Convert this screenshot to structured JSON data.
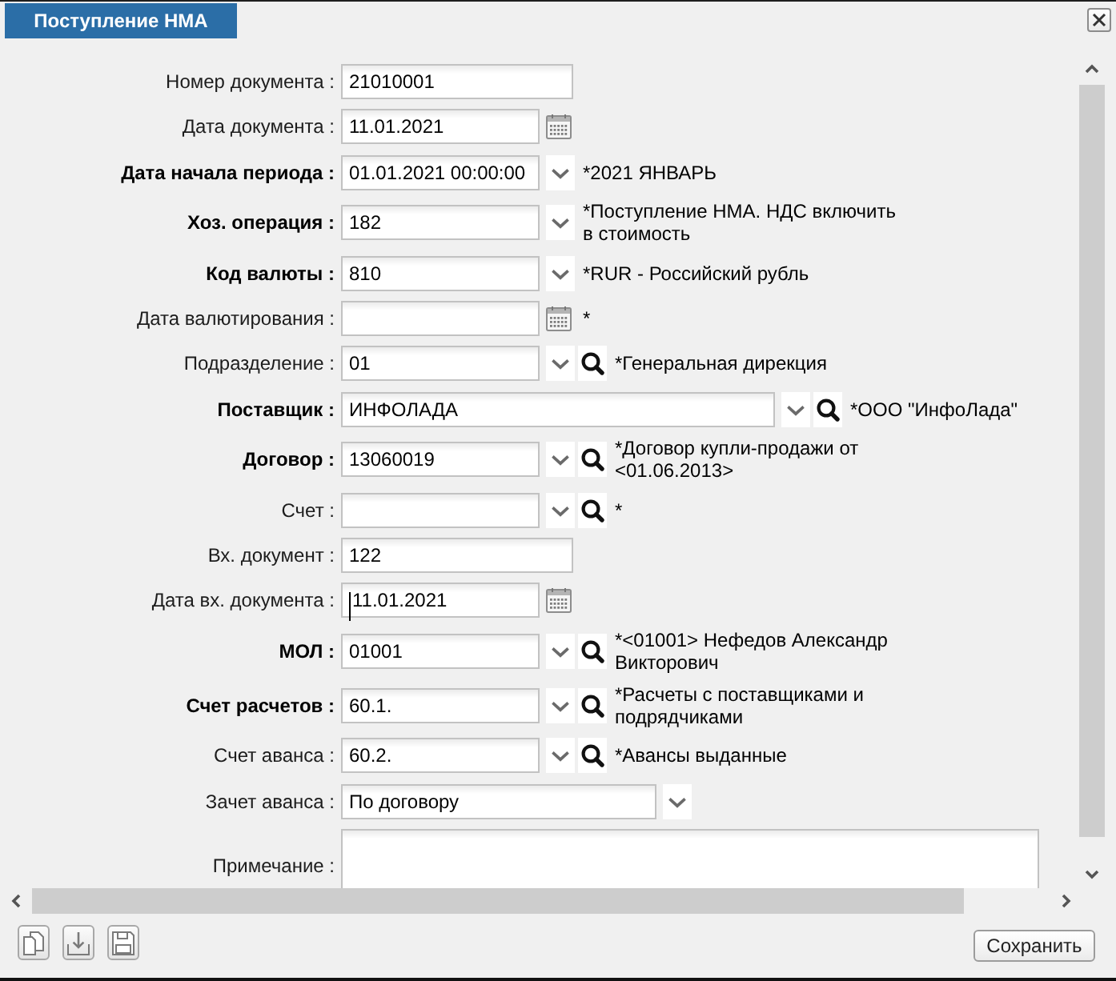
{
  "window": {
    "title": "Поступление НМА"
  },
  "fields": [
    {
      "label": "Номер документа :",
      "required": false,
      "kind": "text",
      "value": "21010001",
      "focused": false
    },
    {
      "label": "Дата документа :",
      "required": false,
      "kind": "date",
      "value": "11.01.2021",
      "focused": false
    },
    {
      "label": "Дата начала периода :",
      "required": true,
      "kind": "dropdown",
      "value": "01.01.2021 00:00:00",
      "note": "*2021 ЯНВАРЬ",
      "focused": false
    },
    {
      "label": "Хоз. операция :",
      "required": true,
      "kind": "dropdown",
      "value": "182",
      "note": "*Поступление НМА. НДС включить в стоимость",
      "focused": false
    },
    {
      "label": "Код валюты :",
      "required": true,
      "kind": "dropdown",
      "value": "810",
      "note": "*RUR - Российский рубль",
      "focused": false
    },
    {
      "label": "Дата валютирования :",
      "required": false,
      "kind": "date",
      "note": "*",
      "focused": false
    },
    {
      "label": "Подразделение :",
      "required": false,
      "kind": "lookup",
      "value": "01",
      "note": "*Генеральная дирекция",
      "focused": false
    },
    {
      "label": "Поставщик :",
      "required": true,
      "kind": "wide-lookup",
      "value": "ИНФОЛАДА",
      "note": "*ООО \"ИнфоЛада\"",
      "focused": false
    },
    {
      "label": "Договор :",
      "required": true,
      "kind": "lookup",
      "value": "13060019",
      "note": "*Договор купли-продажи от <01.06.2013>",
      "focused": false
    },
    {
      "label": "Счет :",
      "required": false,
      "kind": "lookup",
      "note": "*",
      "focused": false
    },
    {
      "label": "Вх. документ :",
      "required": false,
      "kind": "text",
      "value": "122",
      "focused": false
    },
    {
      "label": "Дата вх. документа :",
      "required": false,
      "kind": "date",
      "value": "11.01.2021",
      "focused": true
    },
    {
      "label": "МОЛ :",
      "required": true,
      "kind": "lookup",
      "value": "01001",
      "note": "*<01001> Нефедов Александр Викторович",
      "focused": false
    },
    {
      "label": "Счет расчетов :",
      "required": true,
      "kind": "lookup",
      "value": "60.1.",
      "note": "*Расчеты с поставщиками и подрядчиками",
      "focused": false
    },
    {
      "label": "Счет аванса :",
      "required": false,
      "kind": "lookup",
      "value": "60.2.",
      "note": "*Авансы выданные",
      "focused": false
    },
    {
      "label": "Зачет аванса :",
      "required": false,
      "kind": "select",
      "value": "По договору",
      "focused": false
    },
    {
      "label": "Примечание :",
      "required": false,
      "kind": "memo",
      "focused": false
    }
  ],
  "footer": {
    "save_button": "Сохранить"
  }
}
